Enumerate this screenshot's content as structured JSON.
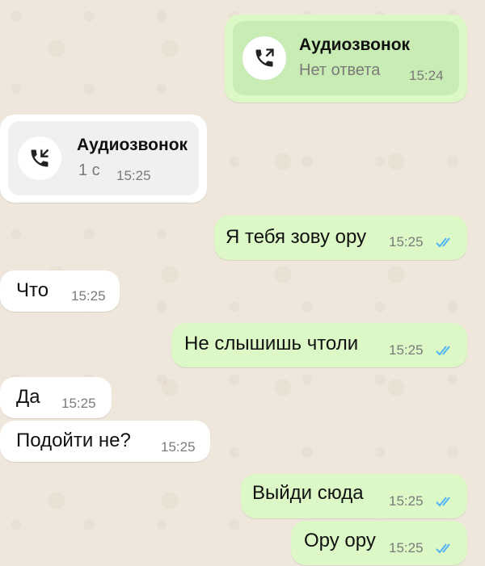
{
  "messages": [
    {
      "type": "call",
      "direction": "outgoing",
      "title": "Аудиозвонок",
      "subtitle": "Нет ответа",
      "time": "15:24",
      "icon": "outgoing-call-icon"
    },
    {
      "type": "call",
      "direction": "incoming",
      "title": "Аудиозвонок",
      "subtitle": "1 с",
      "time": "15:25",
      "icon": "incoming-call-icon"
    },
    {
      "type": "text",
      "direction": "outgoing",
      "text": "Я тебя зову ору",
      "time": "15:25",
      "status": "read"
    },
    {
      "type": "text",
      "direction": "incoming",
      "text": "Что",
      "time": "15:25"
    },
    {
      "type": "text",
      "direction": "outgoing",
      "text": "Не слышишь чтоли",
      "time": "15:25",
      "status": "read"
    },
    {
      "type": "text",
      "direction": "incoming",
      "text": "Да",
      "time": "15:25"
    },
    {
      "type": "text",
      "direction": "incoming",
      "text": "Подойти не?",
      "time": "15:25"
    },
    {
      "type": "text",
      "direction": "outgoing",
      "text": "Выйди сюда",
      "time": "15:25",
      "status": "read"
    },
    {
      "type": "text",
      "direction": "outgoing",
      "text": "Ору ору",
      "time": "15:25",
      "status": "read"
    }
  ],
  "colors": {
    "outgoing_bubble": "#dcf8c6",
    "incoming_bubble": "#ffffff",
    "read_ticks": "#4fb3f6",
    "chat_background": "#efe7dc"
  }
}
